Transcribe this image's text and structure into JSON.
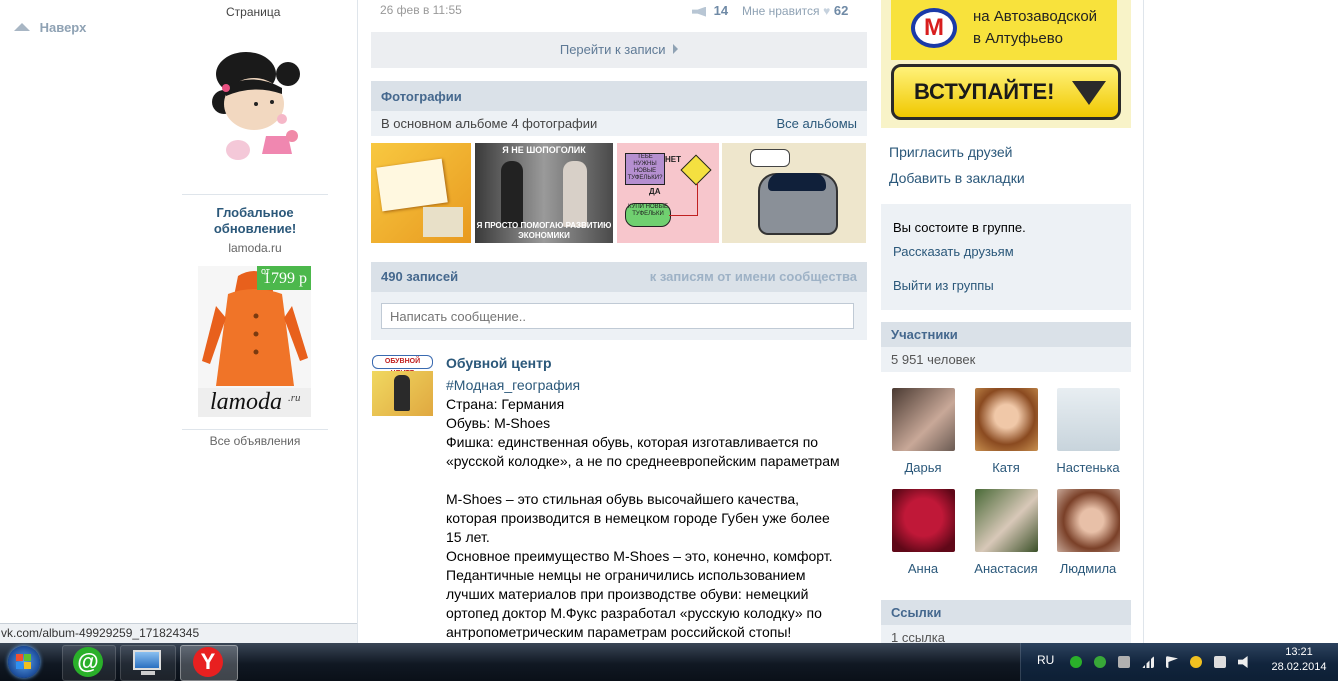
{
  "left": {
    "up_label": "Наверх",
    "page_label": "Страница",
    "ad_title": "Глобальное обновление!",
    "ad_domain": "lamoda.ru",
    "ad_price_prefix": "от",
    "ad_price": "1799 р",
    "ad_logo": "lamoda",
    "ad_logo_suffix": ".ru",
    "all_ads": "Все объявления"
  },
  "status_url": "vk.com/album-49929259_171824345",
  "top_post": {
    "date": "26 фев в 11:55",
    "reposts": "14",
    "like_label": "Мне нравится",
    "likes": "62",
    "go_to_post": "Перейти к записи"
  },
  "photos": {
    "title": "Фотографии",
    "subtitle": "В основном альбоме 4 фотографии",
    "all_albums": "Все альбомы",
    "items": [
      {
        "name": "photo-1",
        "caption": "",
        "bg": "#f0b030"
      },
      {
        "name": "photo-2",
        "caption": "Я НЕ ШОПОГОЛИК / Я ПРОСТО ПОМОГАЮ РАЗВИТИЮ ЭКОНОМИКИ",
        "bg": "#555555"
      },
      {
        "name": "photo-3",
        "caption": "ТЕБЕ НУЖНЫ НОВЫЕ ТУФЕЛЬКИ? / НЕТ / ДА / КУПИ НОВЫЕ ТУФЕЛЬКИ",
        "bg": "#f4c4c8"
      },
      {
        "name": "photo-4",
        "caption": "",
        "bg": "#efe9d4"
      }
    ]
  },
  "wall": {
    "count": "490 записей",
    "community_posts": "к записям от имени сообщества",
    "placeholder": "Написать сообщение.."
  },
  "post": {
    "author": "Обувной центр",
    "hashtag": "#Модная_география",
    "lines": [
      "Страна: Германия",
      "Обувь: M-Shoes",
      "Фишка: единственная обувь, которая изготавливается по",
      "«русской колодке», а не по среднеевропейским параметрам",
      "",
      "M-Shoes – это стильная обувь высочайшего качества,",
      "которая производится в немецком городе Губен уже более",
      "15 лет.",
      "Основное преимущество M-Shoes – это, конечно, комфорт.",
      "Педантичные немцы не ограничились использованием",
      "лучших материалов при производстве обуви: немецкий",
      "ортопед доктор М.Фукс разработал «русскую колодку» по",
      "антропометрическим параметрам российской стопы!"
    ]
  },
  "right": {
    "banner_line1": "на Автозаводской",
    "banner_line2": "в Алтуфьево",
    "banner_metro": "М",
    "banner_button": "ВСТУПАЙТЕ!",
    "invite": "Пригласить друзей",
    "bookmark": "Добавить в закладки",
    "member_status": "Вы состоите в группе.",
    "tell_friends": "Рассказать друзьям",
    "leave": "Выйти из группы",
    "members_title": "Участники",
    "members_count": "5 951 человек",
    "members": [
      {
        "name": "Дарья",
        "color": "#7a6a60"
      },
      {
        "name": "Катя",
        "color": "#b8703c"
      },
      {
        "name": "Настенька",
        "color": "#c8d4dc"
      },
      {
        "name": "Анна",
        "color": "#b01830"
      },
      {
        "name": "Анастасия",
        "color": "#6a7a50"
      },
      {
        "name": "Людмила",
        "color": "#8a5a40"
      }
    ],
    "links_title": "Ссылки",
    "links_count": "1 ссылка"
  },
  "taskbar": {
    "lang": "RU",
    "time": "13:21",
    "date": "28.02.2014"
  },
  "colors": {
    "link": "#2b587a",
    "header_bg": "#dae1e8",
    "header_text": "#45688e",
    "banner_yellow": "#f8e23c"
  }
}
